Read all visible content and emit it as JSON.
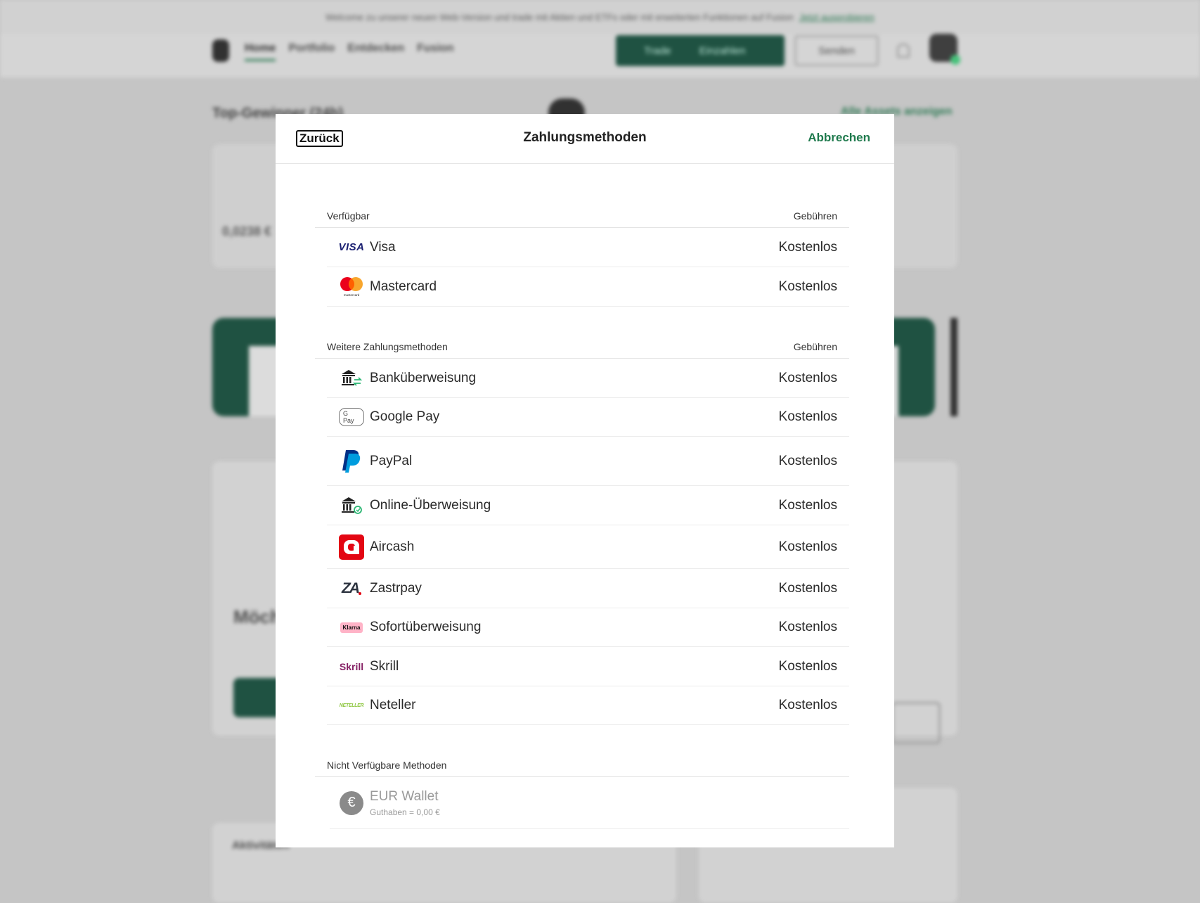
{
  "background": {
    "banner": {
      "text": "Welcome zu unserer neuen Web-Version und trade mit Aktien und ETFs oder mit erweiterten Funktionen auf Fusion",
      "link": "Jetzt ausprobieren"
    },
    "nav": [
      "Home",
      "Portfolio",
      "Entdecken",
      "Fusion"
    ],
    "trade_label": "Trade",
    "deposit_label": "Einzahlen",
    "send_label": "Senden",
    "top_heading": "Top-Gewinner (24h)",
    "show_all": "Alle Assets anzeigen",
    "mini_value": "0,0238 €",
    "big_heading": "Möchtest",
    "activity": "Aktivitäten"
  },
  "modal": {
    "back_label": "Zurück",
    "title": "Zahlungsmethoden",
    "cancel_label": "Abbrechen"
  },
  "sections": {
    "available": {
      "heading": "Verfügbar",
      "fee_heading": "Gebühren",
      "items": [
        {
          "name": "Visa",
          "fee": "Kostenlos",
          "icon": "visa-icon"
        },
        {
          "name": "Mastercard",
          "fee": "Kostenlos",
          "icon": "mastercard-icon"
        }
      ]
    },
    "more": {
      "heading": "Weitere Zahlungsmethoden",
      "fee_heading": "Gebühren",
      "items": [
        {
          "name": "Banküberweisung",
          "fee": "Kostenlos",
          "icon": "bank-transfer-icon"
        },
        {
          "name": "Google Pay",
          "fee": "Kostenlos",
          "icon": "google-pay-icon"
        },
        {
          "name": "PayPal",
          "fee": "Kostenlos",
          "icon": "paypal-icon"
        },
        {
          "name": "Online-Überweisung",
          "fee": "Kostenlos",
          "icon": "online-transfer-icon"
        },
        {
          "name": "Aircash",
          "fee": "Kostenlos",
          "icon": "aircash-icon"
        },
        {
          "name": "Zastrpay",
          "fee": "Kostenlos",
          "icon": "zastrpay-icon"
        },
        {
          "name": "Sofortüberweisung",
          "fee": "Kostenlos",
          "icon": "klarna-icon"
        },
        {
          "name": "Skrill",
          "fee": "Kostenlos",
          "icon": "skrill-icon"
        },
        {
          "name": "Neteller",
          "fee": "Kostenlos",
          "icon": "neteller-icon"
        }
      ]
    },
    "unavailable": {
      "heading": "Nicht Verfügbare Methoden",
      "items": [
        {
          "name": "EUR Wallet",
          "sub": "Guthaben = 0,00 €",
          "icon": "euro-wallet-icon"
        }
      ]
    }
  },
  "logo_text": {
    "visa": "VISA",
    "mastercard": "mastercard",
    "gpay": "G Pay",
    "klarna": "Klarna",
    "skrill": "Skrill",
    "neteller": "NETELLER",
    "zastrpay": "ZA",
    "euro": "€"
  },
  "colors": {
    "accent": "#1f7a4d",
    "dark_green": "#0c4a36",
    "visa_blue": "#1a1f71",
    "mc_red": "#eb001b",
    "mc_orange": "#f79e1b",
    "paypal_dark": "#003087",
    "paypal_light": "#009cde",
    "aircash_red": "#e30613",
    "klarna_pink": "#ffb3c7",
    "skrill_purple": "#862165",
    "neteller_green": "#8dc63f"
  }
}
